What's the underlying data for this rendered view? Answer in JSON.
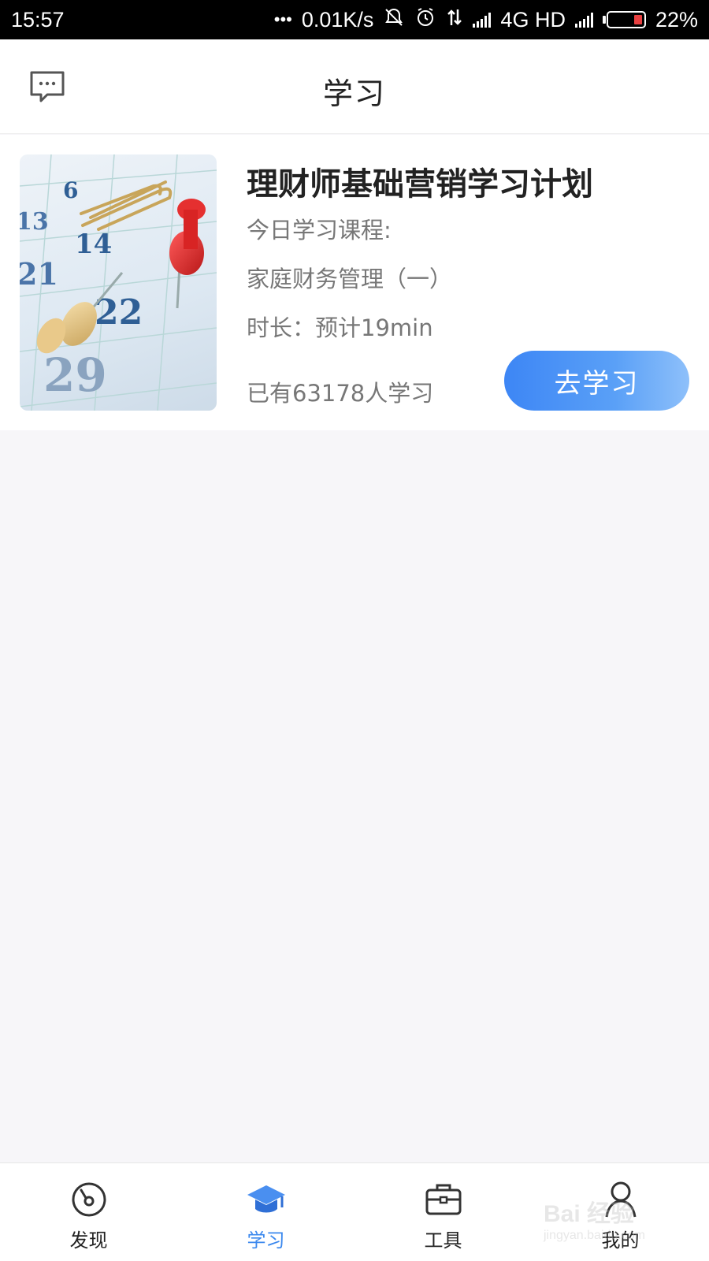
{
  "status_bar": {
    "time": "15:57",
    "dots": "•••",
    "net_speed": "0.01K/s",
    "network": "4G HD",
    "battery": "22%",
    "battery_level": 0.22
  },
  "header": {
    "title": "学习",
    "message_icon": "chat-bubble-icon"
  },
  "course": {
    "title": "理财师基础营销学习计划",
    "today_label": "今日学习课程:",
    "lesson": "家庭财务管理（一）",
    "duration": "时长：预计19min",
    "learners": "已有63178人学习",
    "button": "去学习",
    "accent": "#3d86f5"
  },
  "nav": {
    "items": [
      {
        "label": "发现",
        "icon": "compass-icon"
      },
      {
        "label": "学习",
        "icon": "graduation-cap-icon",
        "active": true
      },
      {
        "label": "工具",
        "icon": "briefcase-icon"
      },
      {
        "label": "我的",
        "icon": "person-icon"
      }
    ],
    "active_color": "#3b88ee"
  },
  "watermark": {
    "brand": "Bai 经验",
    "url": "jingyan.baidu.com"
  }
}
